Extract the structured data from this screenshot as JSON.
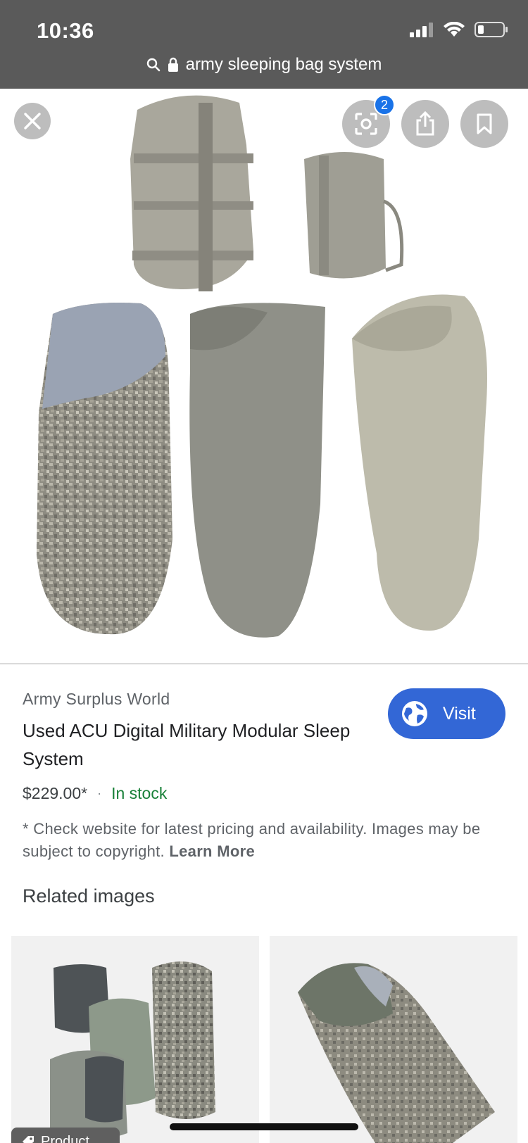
{
  "status_bar": {
    "time": "10:36"
  },
  "url_bar": {
    "text": "army sleeping bag system"
  },
  "hero": {
    "lens_badge_count": "2"
  },
  "product": {
    "source": "Army Surplus World",
    "title": "Used ACU Digital Military Modular Sleep System",
    "visit_label": "Visit",
    "price": "$229.00*",
    "separator": "·",
    "availability": "In stock",
    "disclaimer": "* Check website for latest pricing and availability. Images may be subject to copyright.",
    "learn_more": "Learn More"
  },
  "related": {
    "heading": "Related images",
    "chip_label": "Product"
  },
  "colors": {
    "topbar": "#5a5a5a",
    "visit_button": "#3367d6",
    "in_stock": "#188038",
    "badge": "#1a73e8"
  },
  "icons": [
    "signal-icon",
    "wifi-icon",
    "battery-icon",
    "search-icon",
    "lock-icon",
    "close-icon",
    "lens-icon",
    "share-icon",
    "bookmark-icon",
    "globe-icon",
    "tag-icon"
  ]
}
